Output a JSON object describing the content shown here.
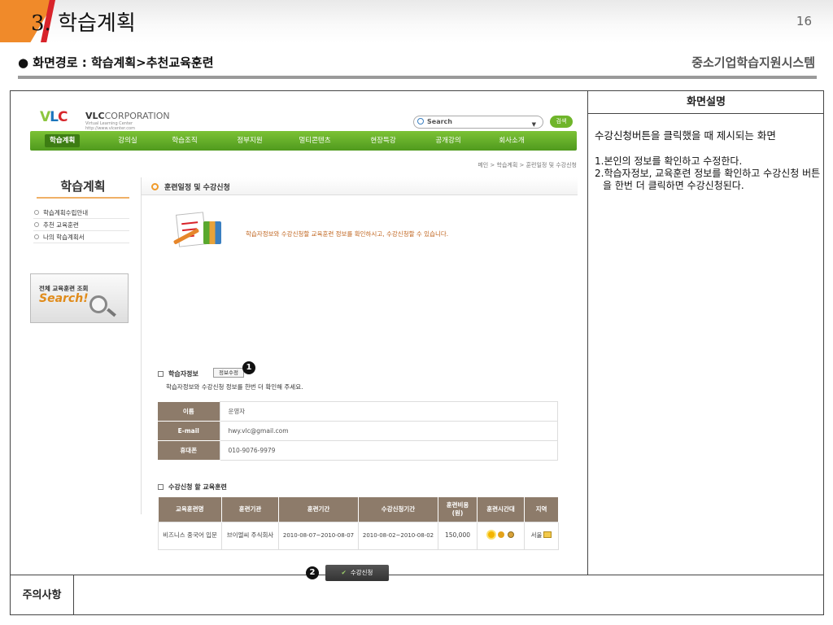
{
  "slide": {
    "number_prefix": "3.",
    "title": "학습계획",
    "page_number": "16",
    "path_label": "● 화면경로 : 학습계획>추천교육훈련",
    "system_name": "중소기업학습지원시스템"
  },
  "description": {
    "header": "화면설명",
    "subtitle": "수강신청버튼을 클릭했을 때 제시되는 화면",
    "items": [
      "1.본인의 정보를 확인하고 수정한다.",
      "2.학습자정보, 교육훈련 정보를 확인하고 수강신청 버튼을 한번 더 클릭하면 수강신청된다."
    ]
  },
  "notes": {
    "label": "주의사항",
    "text": ""
  },
  "site": {
    "logo": {
      "v": "V",
      "l": "L",
      "c": "C",
      "corp_bold": "VLC",
      "corp_thin": "CORPORATION",
      "sub1": "Virtual Learning Center",
      "sub2": "http://www.vlcenter.com"
    },
    "search": {
      "placeholder": "Search",
      "button": "검색"
    },
    "nav": [
      "학습계획",
      "강의실",
      "학습조직",
      "정부지원",
      "멀티콘텐츠",
      "현장특강",
      "공개강의",
      "회사소개"
    ],
    "breadcrumb": "메인 > 학습계획 > 훈련일정 및 수강신청",
    "sidebar": {
      "title": "학습계획",
      "items": [
        "학습계획수립안내",
        "추천 교육훈련",
        "나의 학습계획서"
      ],
      "banner_line1": "전체 교육훈련 조회",
      "banner_line2": "Search!"
    },
    "section_title": "훈련일정 및 수강신청",
    "intro_text": "학습자정보와 수강신청할 교육훈련 정보를 확인하시고, 수강신청할 수 있습니다.",
    "learner": {
      "label": "학습자정보",
      "edit_button": "정보수정",
      "hint": "학습자정보와 수강신청 정보를 한번 더 확인해 주세요.",
      "rows": [
        {
          "key": "이름",
          "value": "운영자"
        },
        {
          "key": "E-mail",
          "value": "hwy.vlc@gmail.com"
        },
        {
          "key": "휴대폰",
          "value": "010-9076-9979"
        }
      ]
    },
    "course": {
      "label": "수강신청 할 교육훈련",
      "headers": [
        "교육훈련명",
        "훈련기관",
        "훈련기간",
        "수강신청기간",
        "훈련비용\n(원)",
        "훈련시간대",
        "지역"
      ],
      "row": {
        "name": "비즈니스 중국어 입문",
        "org": "브이엘씨 주식회사",
        "period": "2010-08-07~2010-08-07",
        "apply_period": "2010-08-02~2010-08-02",
        "cost": "150,000",
        "region": "서울"
      }
    },
    "apply_button": "수강신청",
    "callouts": [
      "1",
      "2"
    ]
  }
}
